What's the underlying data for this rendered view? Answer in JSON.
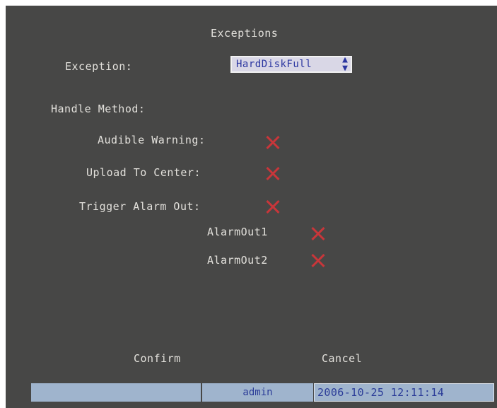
{
  "dialog": {
    "title": "Exceptions",
    "exception_label": "Exception:",
    "exception_value": "HardDiskFull",
    "handle_method_label": "Handle Method:",
    "options": [
      {
        "label": "Audible Warning:",
        "checked": false
      },
      {
        "label": "Upload To Center:",
        "checked": false
      },
      {
        "label": "Trigger Alarm Out:",
        "checked": false
      }
    ],
    "alarm_outputs": [
      {
        "label": "AlarmOut1",
        "checked": false
      },
      {
        "label": "AlarmOut2",
        "checked": false
      }
    ],
    "confirm_label": "Confirm",
    "cancel_label": "Cancel"
  },
  "status_bar": {
    "user": "admin",
    "datetime": "2006-10-25 12:11:14"
  },
  "colors": {
    "background": "#474746",
    "text": "#e3e1dc",
    "unchecked_mark": "#c8363a",
    "status_bar": "#9fb4cd",
    "status_text": "#2b3c98"
  }
}
